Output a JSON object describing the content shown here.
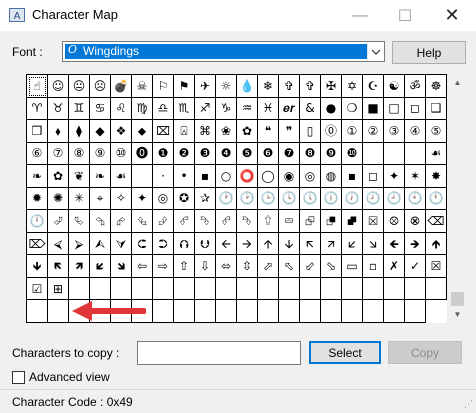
{
  "window": {
    "title": "Character Map",
    "min_glyph": "—",
    "max_glyph": "☐",
    "close_glyph": "✕"
  },
  "font": {
    "label": "Font :",
    "selected": "Wingdings",
    "icon_glyph": "O",
    "dropdown_glyph": "⌄",
    "help_label": "Help"
  },
  "grid": {
    "rows": [
      [
        "☝",
        "☺",
        "😐",
        "☹",
        "💣",
        "☠",
        "⚐",
        "⚑",
        "✈",
        "☼",
        "💧",
        "❄",
        "✞",
        "✞",
        "✠",
        "✡",
        "☪",
        "☯",
        "ॐ",
        "☸"
      ],
      [
        "♈",
        "♉",
        "♊",
        "♋",
        "♌",
        "♍",
        "♎",
        "♏",
        "♐",
        "♑",
        "♒",
        "♓",
        "𝒆𝒓",
        "&",
        "●",
        "❍",
        "■",
        "□",
        "◻",
        "❑"
      ],
      [
        "❒",
        "⬧",
        "⧫",
        "◆",
        "❖",
        "⬥",
        "⌧",
        "⍓",
        "⌘",
        "❀",
        "✿",
        "❝",
        "❞",
        "▯",
        "⓪",
        "①",
        "②",
        "③",
        "④"
      ],
      [
        "⑤",
        "⑥",
        "⑦",
        "⑧",
        "⑨",
        "⑩",
        "⓿",
        "❶",
        "❷",
        "❸",
        "❹",
        "❺",
        "❻",
        "❼",
        "❽",
        "❾",
        "❿",
        "",
        "",
        ""
      ],
      [
        "☙",
        "❧",
        "✿",
        "❦",
        "❧",
        "☙",
        "",
        "·",
        "•",
        "▪",
        "○",
        "⭕",
        "◯",
        "◉",
        "◎",
        "◍",
        "▪",
        "◻",
        "✦",
        "✶"
      ],
      [
        "✸",
        "✹",
        "✺",
        "✳",
        "⌖",
        "✧",
        "✦",
        "◎",
        "✪",
        "✰",
        "🕐",
        "🕑",
        "🕒",
        "🕓",
        "🕔",
        "🕕",
        "🕖",
        "🕗",
        "🕘",
        "🕙"
      ],
      [
        "🕚",
        "🕛",
        "⮰",
        "⮱",
        "⮲",
        "⮳",
        "⮴",
        "⮵",
        "⮶",
        "⮷",
        "⮶",
        "⮷",
        "⮸",
        "⮹",
        "⮺",
        "⮻",
        "⮼",
        "⮽",
        "⮾",
        "⮿"
      ],
      [
        "⌫",
        "⌦",
        "⮘",
        "⮚",
        "⮙",
        "⮛",
        "⮈",
        "⮊",
        "⮉",
        "⮋",
        "🡨",
        "🡪",
        "🡩",
        "🡫",
        "🡬",
        "🡭",
        "🡯",
        "🡮",
        "🡸",
        "🡺"
      ],
      [
        "🡹",
        "🡻",
        "🡼",
        "🡽",
        "🡿",
        "🡾",
        "⇦",
        "⇨",
        "⇧",
        "⇩",
        "⬄",
        "⇳",
        "⬀",
        "⬁",
        "⬃",
        "⬂",
        "▭",
        "▫",
        "✗",
        "✓"
      ],
      [
        "☒",
        "☑",
        "⊞",
        "",
        "",
        "",
        "",
        "",
        "",
        "",
        "",
        "",
        "",
        "",
        "",
        "",
        "",
        "",
        "",
        ""
      ],
      [
        "",
        "",
        "",
        "",
        "",
        "",
        "",
        "",
        "",
        "",
        "",
        "",
        "",
        "",
        "",
        "",
        "",
        "",
        "",
        ""
      ]
    ]
  },
  "annotation": {
    "arrow_color": "#e0363a"
  },
  "bottom": {
    "copy_label": "Characters to copy :",
    "copy_value": "",
    "select_label": "Select",
    "copy_label_btn": "Copy",
    "advanced_label": "Advanced view"
  },
  "status": {
    "text": "Character Code : 0x49"
  },
  "colors": {
    "accent": "#0078d7",
    "window_bg": "#f0f0f0"
  }
}
